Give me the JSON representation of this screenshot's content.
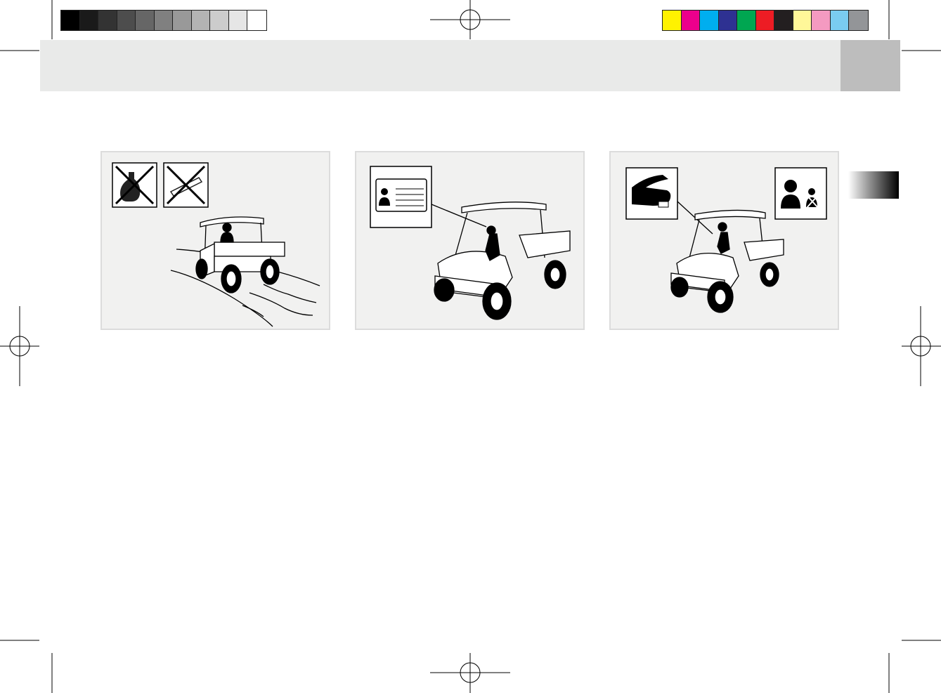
{
  "color_bar": {
    "grayscale": [
      "#000000",
      "#1a1a1a",
      "#333333",
      "#4d4d4d",
      "#666666",
      "#808080",
      "#999999",
      "#b3b3b3",
      "#cccccc",
      "#e6e6e6",
      "#ffffff"
    ],
    "process": [
      "#fff200",
      "#ec008c",
      "#00aeef",
      "#2e3192",
      "#00a651",
      "#ed1c24",
      "#231f20",
      "#fff799",
      "#f49ac1",
      "#7accf0",
      "#939598"
    ]
  },
  "header": {
    "band_color": "#e9eae9",
    "tab_color": "#bdbdbd"
  },
  "side_tab": {
    "gradient_end": "#000000"
  },
  "panels": [
    {
      "id": "no-alcohol-no-drugs",
      "icons": [
        "no-alcohol-icon",
        "no-drugs-icon"
      ]
    },
    {
      "id": "license-required",
      "icons": [
        "driver-license-icon"
      ]
    },
    {
      "id": "seatbelt-no-passenger",
      "icons": [
        "seatbelt-hand-icon",
        "no-extra-passenger-icon"
      ]
    }
  ]
}
